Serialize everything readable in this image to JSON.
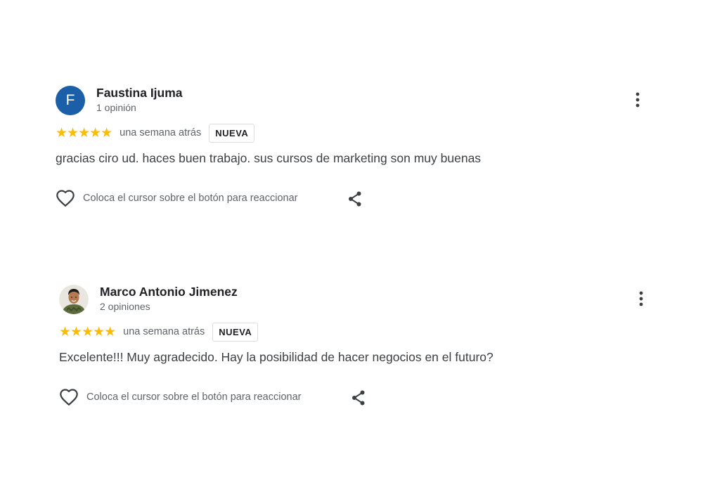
{
  "reviews": [
    {
      "avatar": {
        "type": "letter",
        "letter": "F",
        "color": "#1a5fa8"
      },
      "name": "Faustina Ijuma",
      "meta": "1 opinión",
      "stars": "★★★★★",
      "rating": 5,
      "date": "una semana atrás",
      "badge": "NUEVA",
      "text": "gracias ciro ud. haces buen trabajo. sus cursos de marketing son muy buenas",
      "react_hint": "Coloca el cursor sobre el botón para reaccionar",
      "icons": {
        "menu": "more-vertical-icon",
        "react": "heart-icon",
        "share": "share-icon"
      }
    },
    {
      "avatar": {
        "type": "photo"
      },
      "name": "Marco Antonio Jimenez",
      "meta": "2 opiniones",
      "stars": "★★★★★",
      "rating": 5,
      "date": "una semana atrás",
      "badge": "NUEVA",
      "text": "Excelente!!! Muy agradecido. Hay la posibilidad de hacer negocios en el futuro?",
      "react_hint": "Coloca el cursor sobre el botón para reaccionar",
      "icons": {
        "menu": "more-vertical-icon",
        "react": "heart-icon",
        "share": "share-icon"
      }
    }
  ],
  "colors": {
    "star": "#fbbc04",
    "name": "#202124",
    "secondary_text": "#5f6368",
    "body_text": "#3c4043",
    "badge_border": "#dadce0",
    "icon": "#3c4043"
  }
}
